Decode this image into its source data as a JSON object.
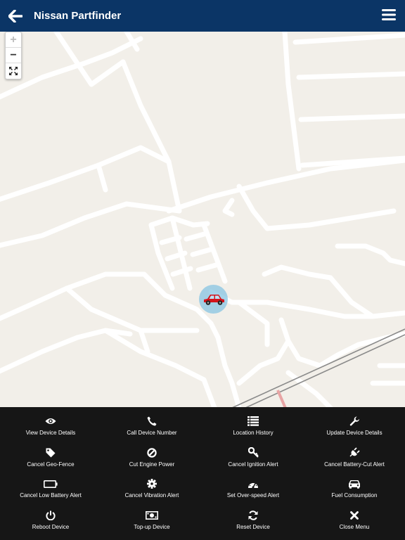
{
  "header": {
    "title": "Nissan Partfinder"
  },
  "map": {
    "zoom_in": "+",
    "zoom_out": "−"
  },
  "colors": {
    "header_bg": "#0b3566",
    "menu_bg": "#161616",
    "map_bg": "#f2efe9",
    "car": "#d4141b",
    "marker": "#87c4e2"
  },
  "menu": {
    "items": [
      {
        "label": "View Device Details",
        "icon": "eye-icon"
      },
      {
        "label": "Call Device Number",
        "icon": "phone-icon"
      },
      {
        "label": "Location History",
        "icon": "list-icon"
      },
      {
        "label": "Update Device Details",
        "icon": "wrench-icon"
      },
      {
        "label": "Cancel Geo-Fence",
        "icon": "tag-icon"
      },
      {
        "label": "Cut Engine Power",
        "icon": "ban-icon"
      },
      {
        "label": "Cancel Ignition Alert",
        "icon": "key-icon"
      },
      {
        "label": "Cancel Battery-Cut Alert",
        "icon": "plug-icon"
      },
      {
        "label": "Cancel Low Battery Alert",
        "icon": "battery-empty-icon"
      },
      {
        "label": "Cancel Vibration Alert",
        "icon": "gear-icon"
      },
      {
        "label": "Set Over-speed Alert",
        "icon": "speedometer-icon"
      },
      {
        "label": "Fuel Consumption",
        "icon": "car-icon"
      },
      {
        "label": "Reboot Device",
        "icon": "power-icon"
      },
      {
        "label": "Top-up Device",
        "icon": "money-icon"
      },
      {
        "label": "Reset Device",
        "icon": "refresh-icon"
      },
      {
        "label": "Close Menu",
        "icon": "close-icon"
      }
    ]
  }
}
